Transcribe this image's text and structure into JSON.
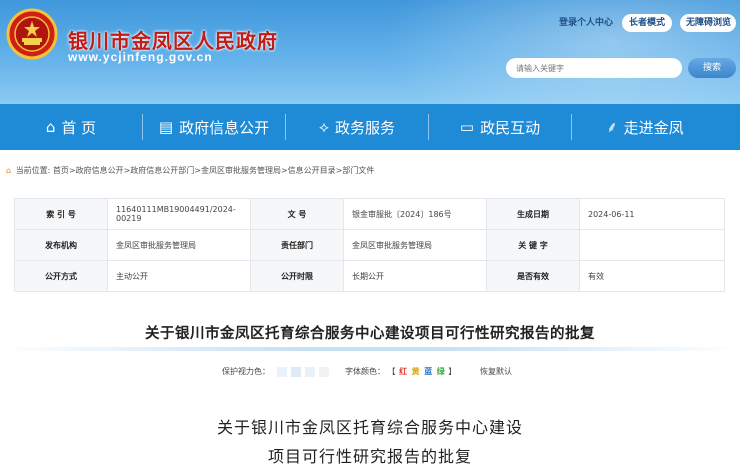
{
  "header": {
    "site_title": "银川市金凤区人民政府",
    "site_url": "www.ycjinfeng.gov.cn",
    "links": {
      "login": "登录个人中心",
      "elder_mode": "长者模式",
      "accessibility": "无障碍浏览"
    },
    "search": {
      "placeholder": "请输入关键字",
      "button": "搜索"
    }
  },
  "nav": {
    "items": [
      {
        "label": "首 页",
        "icon": "home-icon"
      },
      {
        "label": "政府信息公开",
        "icon": "book-icon"
      },
      {
        "label": "政务服务",
        "icon": "handshake-icon"
      },
      {
        "label": "政民互动",
        "icon": "chat-icon"
      },
      {
        "label": "走进金凤",
        "icon": "feather-icon"
      }
    ]
  },
  "breadcrumb": {
    "prefix": "当前位置:",
    "path": "首页>政府信息公开>政府信息公开部门>金凤区审批服务管理局>信息公开目录>部门文件"
  },
  "info_table": {
    "index_label": "索 引 号",
    "index_value": "11640111MB19004491/2024-00219",
    "doc_no_label": "文    号",
    "doc_no_value": "银金审服批〔2024〕186号",
    "date_label": "生成日期",
    "date_value": "2024-06-11",
    "org_label": "发布机构",
    "org_value": "金凤区审批服务管理局",
    "dept_label": "责任部门",
    "dept_value": "金凤区审批服务管理局",
    "keyword_label": "关 键 字",
    "keyword_value": "",
    "mode_label": "公开方式",
    "mode_value": "主动公开",
    "scope_label": "公开时限",
    "scope_value": "长期公开",
    "valid_label": "是否有效",
    "valid_value": "有效"
  },
  "article": {
    "title": "关于银川市金凤区托育综合服务中心建设项目可行性研究报告的批复",
    "body_title_line1": "关于银川市金凤区托育综合服务中心建设",
    "body_title_line2": "项目可行性研究报告的批复"
  },
  "tools": {
    "eye_label": "保护视力色：",
    "font_color_label": "字体颜色：",
    "bracket_open": "【",
    "bracket_close": "】",
    "colors": {
      "red": "红",
      "yellow": "黄",
      "blue": "蓝",
      "green": "绿"
    },
    "reset": "恢复默认",
    "eye_swatches": [
      "#eaf2fb",
      "#dfeaf6",
      "#e8f0f8",
      "#f2f2f2"
    ],
    "font_colors_hex": {
      "red": "#e53a2f",
      "yellow": "#e0a800",
      "blue": "#2a72c8",
      "green": "#3aa845"
    }
  },
  "colors": {
    "header_blue": "#3f97db",
    "nav_blue": "#1f8ad6",
    "title_red": "#c21a14"
  }
}
